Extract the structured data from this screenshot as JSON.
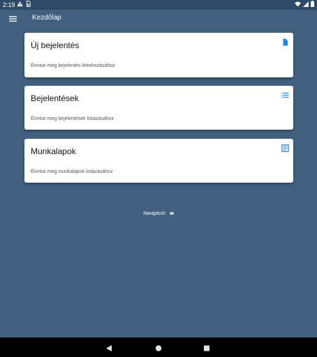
{
  "status_bar": {
    "time": "2:19",
    "icons": [
      "warning-icon",
      "sim-icon",
      "wifi-icon",
      "signal-icon",
      "battery-icon"
    ]
  },
  "app_bar": {
    "title": "Kezdőlap",
    "menu_icon": "menu-icon"
  },
  "cards": [
    {
      "title": "Új bejelentés",
      "subtitle": "Érintse meg bejelentés létrehozásához",
      "icon": "document-icon"
    },
    {
      "title": "Bejelentések",
      "subtitle": "Érintse meg bejelentések listázásához",
      "icon": "list-icon"
    },
    {
      "title": "Munkalapok",
      "subtitle": "Érintse meg munkalapok listázásához",
      "icon": "worksheet-icon"
    }
  ],
  "navigation": {
    "label": "Navigáció:"
  },
  "system_nav": {
    "buttons": [
      "back-icon",
      "home-icon",
      "recents-icon"
    ]
  },
  "colors": {
    "background": "#41607f",
    "status_bar": "#2f4a66",
    "card": "#ffffff",
    "icon_accent": "#1e88e5",
    "system_nav": "#000000"
  }
}
